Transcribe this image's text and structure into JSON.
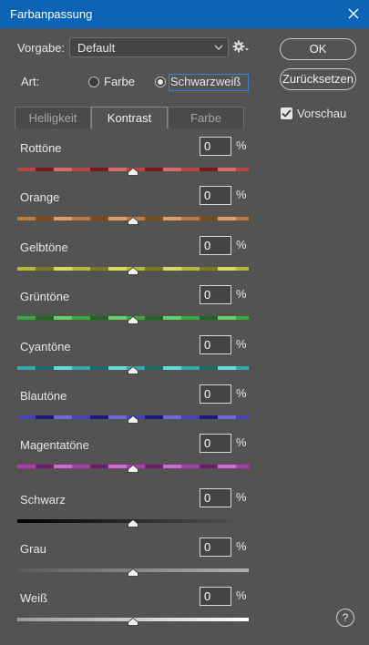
{
  "window": {
    "title": "Farbanpassung"
  },
  "preset": {
    "label": "Vorgabe:",
    "value": "Default"
  },
  "mode": {
    "label": "Art:",
    "option_color": "Farbe",
    "option_bw": "Schwarzweiß",
    "selected": "Schwarzweiß"
  },
  "buttons": {
    "ok": "OK",
    "reset": "Zurücksetzen"
  },
  "preview": {
    "label": "Vorschau",
    "checked": true
  },
  "tabs": [
    {
      "label": "Helligkeit",
      "active": false
    },
    {
      "label": "Kontrast",
      "active": true
    },
    {
      "label": "Farbe",
      "active": false
    }
  ],
  "rows": [
    {
      "label": "Rottöne",
      "value": "0",
      "unit": "%",
      "slider_value": 0,
      "colors": [
        "#b84444",
        "#7a1a1a",
        "#d86a6a"
      ]
    },
    {
      "label": "Orange",
      "value": "0",
      "unit": "%",
      "slider_value": 0,
      "colors": [
        "#c07a3c",
        "#7f4a1c",
        "#e0a060"
      ]
    },
    {
      "label": "Gelbtöne",
      "value": "0",
      "unit": "%",
      "slider_value": 0,
      "colors": [
        "#b8b83a",
        "#7a7a1a",
        "#dada60"
      ]
    },
    {
      "label": "Grüntöne",
      "value": "0",
      "unit": "%",
      "slider_value": 0,
      "colors": [
        "#3aa83a",
        "#1a6a1a",
        "#66d066"
      ]
    },
    {
      "label": "Cyantöne",
      "value": "0",
      "unit": "%",
      "slider_value": 0,
      "colors": [
        "#3aa8a8",
        "#1a6a6a",
        "#66d8d8"
      ]
    },
    {
      "label": "Blautöne",
      "value": "0",
      "unit": "%",
      "slider_value": 0,
      "colors": [
        "#4444b8",
        "#1a1a7a",
        "#6a6ad8"
      ]
    },
    {
      "label": "Magentatöne",
      "value": "0",
      "unit": "%",
      "slider_value": 0,
      "colors": [
        "#b03ab0",
        "#6a1a6a",
        "#d866d8"
      ]
    },
    {
      "label": "Schwarz",
      "value": "0",
      "unit": "%",
      "slider_value": 0,
      "colors": [
        "#000000",
        "#555555"
      ]
    },
    {
      "label": "Grau",
      "value": "0",
      "unit": "%",
      "slider_value": 0,
      "colors": [
        "#5a5a5a",
        "#b0b0b0"
      ]
    },
    {
      "label": "Weiß",
      "value": "0",
      "unit": "%",
      "slider_value": 0,
      "colors": [
        "#9a9a9a",
        "#ffffff"
      ]
    }
  ],
  "help": {
    "label": "?"
  }
}
